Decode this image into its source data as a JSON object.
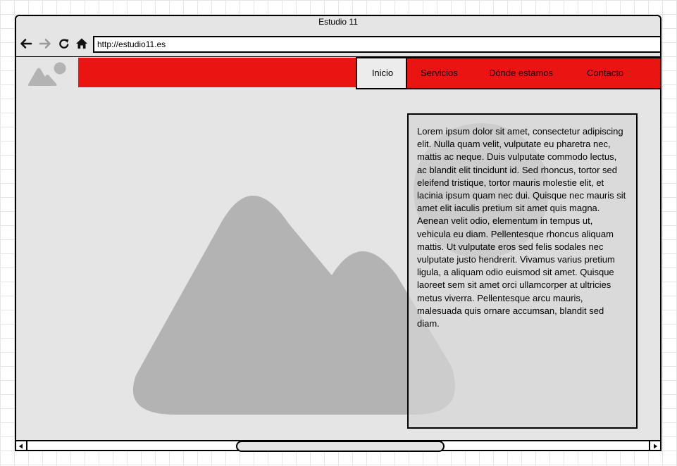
{
  "browser": {
    "title": "Estudio 11",
    "url": "http://estudio11.es",
    "buttons": [
      "back-icon",
      "forward-icon",
      "reload-icon",
      "home-icon"
    ]
  },
  "site": {
    "logo_icon": "image-placeholder-icon",
    "nav": [
      {
        "label": "Inicio",
        "active": true
      },
      {
        "label": "Servicios"
      },
      {
        "label": "Dónde estamos"
      },
      {
        "label": "Contacto"
      }
    ],
    "hero_icon": "image-placeholder-icon",
    "text": "Lorem ipsum dolor sit amet, consectetur adipiscing elit. Nulla quam velit, vulputate eu pharetra nec, mattis ac neque. Duis vulputate commodo lectus, ac blandit elit tincidunt id. Sed rhoncus, tortor sed eleifend tristique, tortor mauris molestie elit, et lacinia ipsum quam nec dui. Quisque nec mauris sit amet elit iaculis pretium sit amet quis magna. Aenean velit odio, elementum in tempus ut, vehicula eu diam. Pellentesque rhoncus aliquam mattis. Ut vulputate eros sed felis sodales nec vulputate justo hendrerit. Vivamus varius pretium ligula, a aliquam odio euismod sit amet. Quisque laoreet sem sit amet orci ullamcorper at ultricies metus viverra. Pellentesque arcu mauris, malesuada quis ornare accumsan, blandit sed diam."
  },
  "colors": {
    "accent_red": "#ea1512",
    "page_bg": "#e5e5e5",
    "placeholder_gray": "#b3b3b3"
  },
  "scrollbar": {
    "icons": [
      "scroll-left-icon",
      "scroll-right-icon"
    ]
  }
}
